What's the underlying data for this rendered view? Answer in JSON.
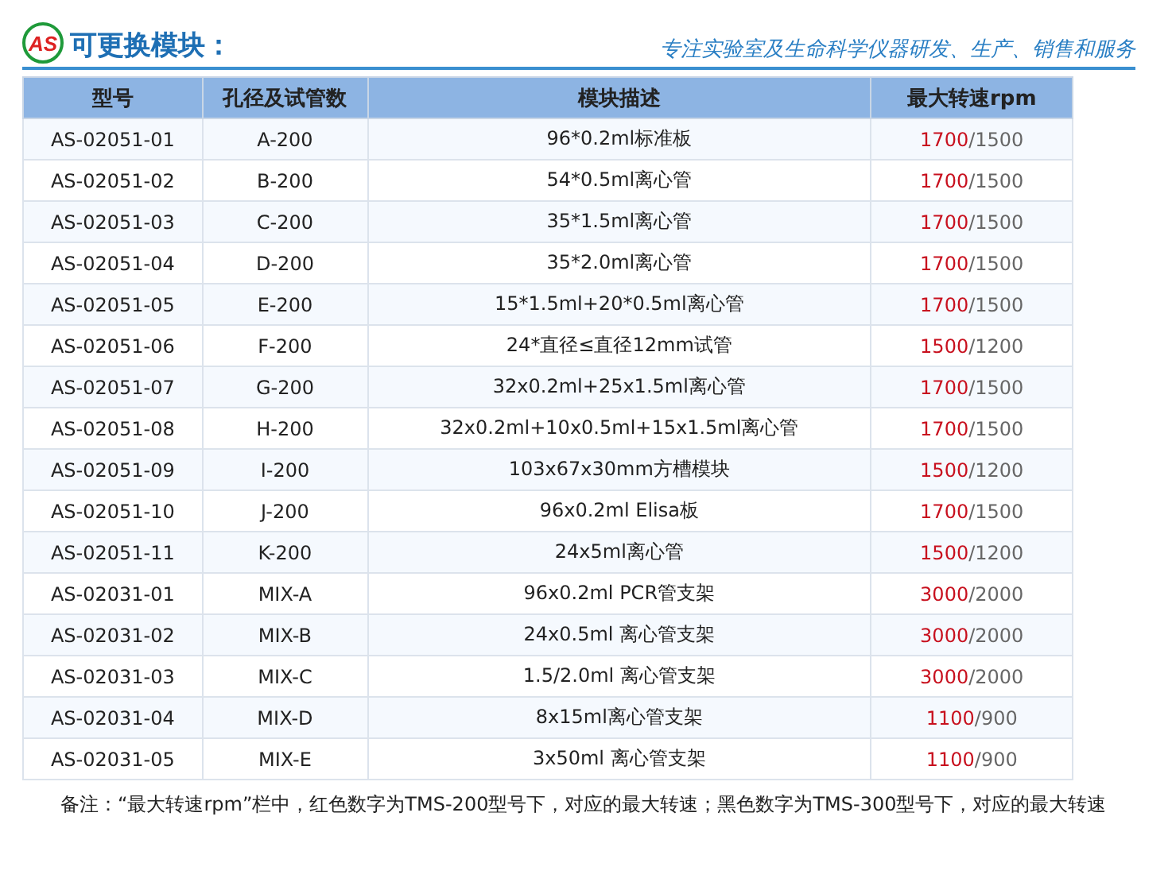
{
  "header": {
    "logo_text": "AS",
    "title": "可更换模块：",
    "slogan": "专注实验室及生命科学仪器研发、生产、销售和服务"
  },
  "table": {
    "columns": [
      "型号",
      "孔径及试管数",
      "模块描述",
      "最大转速rpm"
    ],
    "rows": [
      {
        "model": "AS-02051-01",
        "code": "A-200",
        "description": "96*0.2ml标准板",
        "speed": "1700",
        "speed_alt": "/1500"
      },
      {
        "model": "AS-02051-02",
        "code": "B-200",
        "description": "54*0.5ml离心管",
        "speed": "1700",
        "speed_alt": "/1500"
      },
      {
        "model": "AS-02051-03",
        "code": "C-200",
        "description": "35*1.5ml离心管",
        "speed": "1700",
        "speed_alt": "/1500"
      },
      {
        "model": "AS-02051-04",
        "code": "D-200",
        "description": "35*2.0ml离心管",
        "speed": "1700",
        "speed_alt": "/1500"
      },
      {
        "model": "AS-02051-05",
        "code": "E-200",
        "description": "15*1.5ml+20*0.5ml离心管",
        "speed": "1700",
        "speed_alt": "/1500"
      },
      {
        "model": "AS-02051-06",
        "code": "F-200",
        "description": "24*直径≤直径12mm试管",
        "speed": "1500",
        "speed_alt": "/1200"
      },
      {
        "model": "AS-02051-07",
        "code": "G-200",
        "description": "32x0.2ml+25x1.5ml离心管",
        "speed": "1700",
        "speed_alt": "/1500"
      },
      {
        "model": "AS-02051-08",
        "code": "H-200",
        "description": "32x0.2ml+10x0.5ml+15x1.5ml离心管",
        "speed": "1700",
        "speed_alt": "/1500"
      },
      {
        "model": "AS-02051-09",
        "code": "I-200",
        "description": "103x67x30mm方槽模块",
        "speed": "1500",
        "speed_alt": "/1200"
      },
      {
        "model": "AS-02051-10",
        "code": "J-200",
        "description": "96x0.2ml Elisa板",
        "speed": "1700",
        "speed_alt": "/1500"
      },
      {
        "model": "AS-02051-11",
        "code": "K-200",
        "description": "24x5ml离心管",
        "speed": "1500",
        "speed_alt": "/1200"
      },
      {
        "model": "AS-02031-01",
        "code": "MIX-A",
        "description": "96x0.2ml PCR管支架",
        "speed": "3000",
        "speed_alt": "/2000"
      },
      {
        "model": "AS-02031-02",
        "code": "MIX-B",
        "description": "24x0.5ml 离心管支架",
        "speed": "3000",
        "speed_alt": "/2000"
      },
      {
        "model": "AS-02031-03",
        "code": "MIX-C",
        "description": "1.5/2.0ml 离心管支架",
        "speed": "3000",
        "speed_alt": "/2000"
      },
      {
        "model": "AS-02031-04",
        "code": "MIX-D",
        "description": "8x15ml离心管支架",
        "speed": "1100",
        "speed_alt": "/900"
      },
      {
        "model": "AS-02031-05",
        "code": "MIX-E",
        "description": "3x50ml 离心管支架",
        "speed": "1100",
        "speed_alt": "/900"
      }
    ]
  },
  "note": "备注：“最大转速rpm”栏中，红色数字为TMS-200型号下，对应的最大转速；黑色数字为TMS-300型号下，对应的最大转速"
}
